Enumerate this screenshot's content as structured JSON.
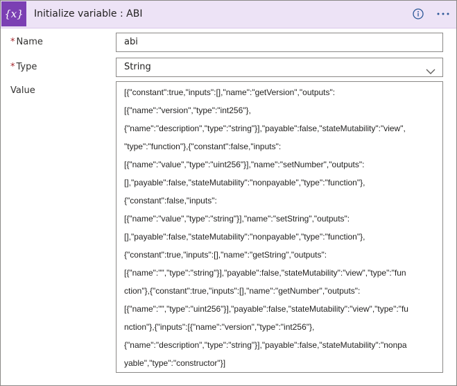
{
  "header": {
    "icon_glyph": "{x}",
    "icon_name": "variable-icon",
    "title": "Initialize variable : ABI",
    "info_icon": "info-icon",
    "more_icon": "more-options-icon",
    "accent_color": "#7b3fb3",
    "background_color": "#ede3f6"
  },
  "fields": {
    "name": {
      "required_mark": "*",
      "label": "Name",
      "value": "abi"
    },
    "type": {
      "required_mark": "*",
      "label": "Type",
      "value": "String",
      "icon": "chevron-down-icon"
    },
    "value": {
      "label": "Value",
      "lines": [
        "[{\"constant\":true,\"inputs\":[],\"name\":\"getVersion\",\"outputs\":",
        "[{\"name\":\"version\",\"type\":\"int256\"},",
        "{\"name\":\"description\",\"type\":\"string\"}],\"payable\":false,\"stateMutability\":\"view\",",
        "\"type\":\"function\"},{\"constant\":false,\"inputs\":",
        "[{\"name\":\"value\",\"type\":\"uint256\"}],\"name\":\"setNumber\",\"outputs\":",
        "[],\"payable\":false,\"stateMutability\":\"nonpayable\",\"type\":\"function\"},",
        "{\"constant\":false,\"inputs\":",
        "[{\"name\":\"value\",\"type\":\"string\"}],\"name\":\"setString\",\"outputs\":",
        "[],\"payable\":false,\"stateMutability\":\"nonpayable\",\"type\":\"function\"},",
        "{\"constant\":true,\"inputs\":[],\"name\":\"getString\",\"outputs\":",
        "[{\"name\":\"\",\"type\":\"string\"}],\"payable\":false,\"stateMutability\":\"view\",\"type\":\"fun",
        "ction\"},{\"constant\":true,\"inputs\":[],\"name\":\"getNumber\",\"outputs\":",
        "[{\"name\":\"\",\"type\":\"uint256\"}],\"payable\":false,\"stateMutability\":\"view\",\"type\":\"fu",
        "nction\"},{\"inputs\":[{\"name\":\"version\",\"type\":\"int256\"},",
        "{\"name\":\"description\",\"type\":\"string\"}],\"payable\":false,\"stateMutability\":\"nonpa",
        "yable\",\"type\":\"constructor\"}]"
      ]
    }
  }
}
